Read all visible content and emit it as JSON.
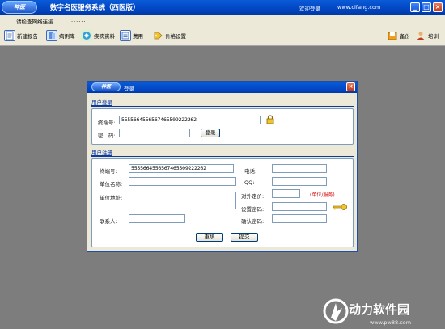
{
  "window": {
    "logo_text": "神医",
    "title": "数字名医服务系统（西医版）",
    "welcome": "欢迎登录",
    "site": "www.cifang.com",
    "min_symbol": "_",
    "max_symbol": "□",
    "close_symbol": "×"
  },
  "status": {
    "text": "请检查网络连接",
    "dots": "......"
  },
  "toolbar": {
    "items": [
      {
        "label": "新建报告",
        "icon": "new-report-icon"
      },
      {
        "label": "病例库",
        "icon": "case-library-icon"
      },
      {
        "label": "疾病资料",
        "icon": "disease-info-icon"
      },
      {
        "label": "费用",
        "icon": "fee-icon"
      },
      {
        "label": "价格设置",
        "icon": "price-settings-icon"
      },
      {
        "label": "备份",
        "icon": "backup-icon"
      },
      {
        "label": "培训",
        "icon": "training-icon"
      }
    ]
  },
  "dialog": {
    "logo_text": "神医",
    "title": "登录",
    "close_symbol": "×",
    "login": {
      "section_title": "用户登录",
      "terminal_label": "终端号:",
      "terminal_value": "5555664556567465509222262",
      "password_label": "密　码:",
      "password_value": "",
      "login_button": "登录"
    },
    "register": {
      "section_title": "用户注册",
      "terminal_label": "终端号:",
      "terminal_value": "5555664556567465509222262",
      "company_label": "单位名称:",
      "address_label": "单位地址:",
      "contact_label": "联系人:",
      "phone_label": "电话:",
      "qq_label": "QQ:",
      "external_price_label": "对外定价:",
      "required_note": "(单位/服务)",
      "set_password_label": "设置密码:",
      "confirm_password_label": "确认密码:",
      "reset_button": "重填",
      "submit_button": "提交"
    }
  },
  "watermark": {
    "text": "动力软件园",
    "url": "www.pw88.com"
  },
  "colors": {
    "titlebar": "#0246c2",
    "desktop": "#7d7d7d",
    "section": "#0b3aa6",
    "required": "#d40000"
  }
}
